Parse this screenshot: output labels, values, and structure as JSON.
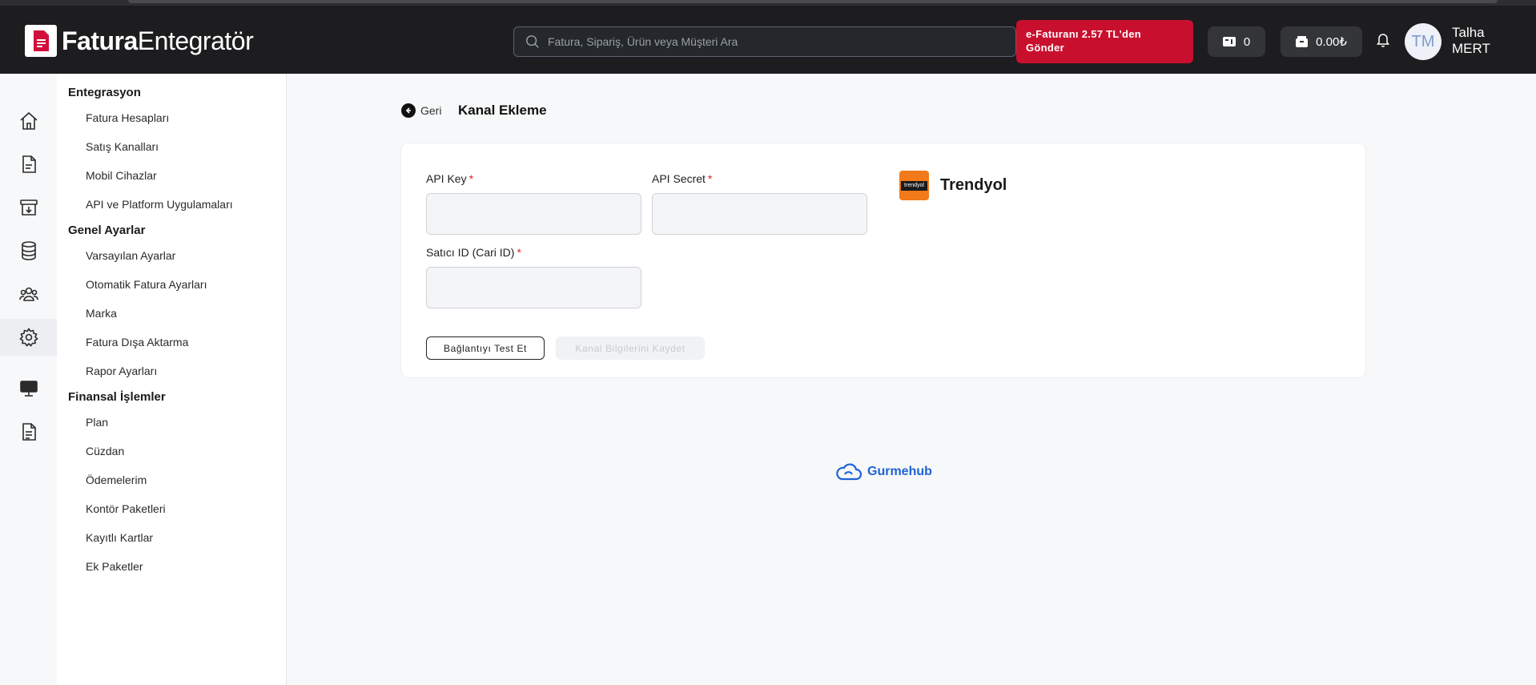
{
  "header": {
    "logo_bold": "Fatura",
    "logo_light": "Entegratör",
    "search_placeholder": "Fatura, Sipariş, Ürün veya Müşteri Ara",
    "promo_line1": "e-Faturanı 2.57 TL'den",
    "promo_line2": "Gönder",
    "counter_value": "0",
    "balance_value": "0.00₺",
    "avatar_initials": "TM",
    "user_first": "Talha",
    "user_last": "MERT"
  },
  "rail": {
    "icons": [
      "home-icon",
      "document-icon",
      "archive-icon",
      "database-icon",
      "users-icon",
      "gear-icon",
      "monitor-icon",
      "file-text-icon"
    ],
    "active": "gear-icon"
  },
  "sidebar": {
    "sections": [
      {
        "title": "Entegrasyon",
        "items": [
          "Fatura Hesapları",
          "Satış Kanalları",
          "Mobil Cihazlar",
          "API ve Platform Uygulamaları"
        ]
      },
      {
        "title": "Genel Ayarlar",
        "items": [
          "Varsayılan Ayarlar",
          "Otomatik Fatura Ayarları",
          "Marka",
          "Fatura Dışa Aktarma",
          "Rapor Ayarları"
        ]
      },
      {
        "title": "Finansal İşlemler",
        "items": [
          "Plan",
          "Cüzdan",
          "Ödemelerim",
          "Kontör Paketleri",
          "Kayıtlı Kartlar",
          "Ek Paketler"
        ]
      }
    ]
  },
  "main": {
    "back_label": "Geri",
    "page_title": "Kanal Ekleme",
    "form": {
      "api_key_label": "API Key",
      "api_secret_label": "API Secret",
      "seller_id_label": "Satıcı ID (Cari ID)",
      "required_mark": "*",
      "api_key_value": "",
      "api_secret_value": "",
      "seller_id_value": ""
    },
    "test_button": "Bağlantıyı Test Et",
    "save_button": "Kanal Bilgilerini Kaydet",
    "channel_logo_text": "trendyol",
    "channel_name": "Trendyol"
  },
  "footer": {
    "brand": "Gurmehub"
  },
  "colors": {
    "header_bg": "#1d1d1f",
    "promo_bg": "#c8102e",
    "accent_blue": "#1e63d6",
    "trendyol_orange": "#f27a1a",
    "required_red": "#e02424"
  }
}
